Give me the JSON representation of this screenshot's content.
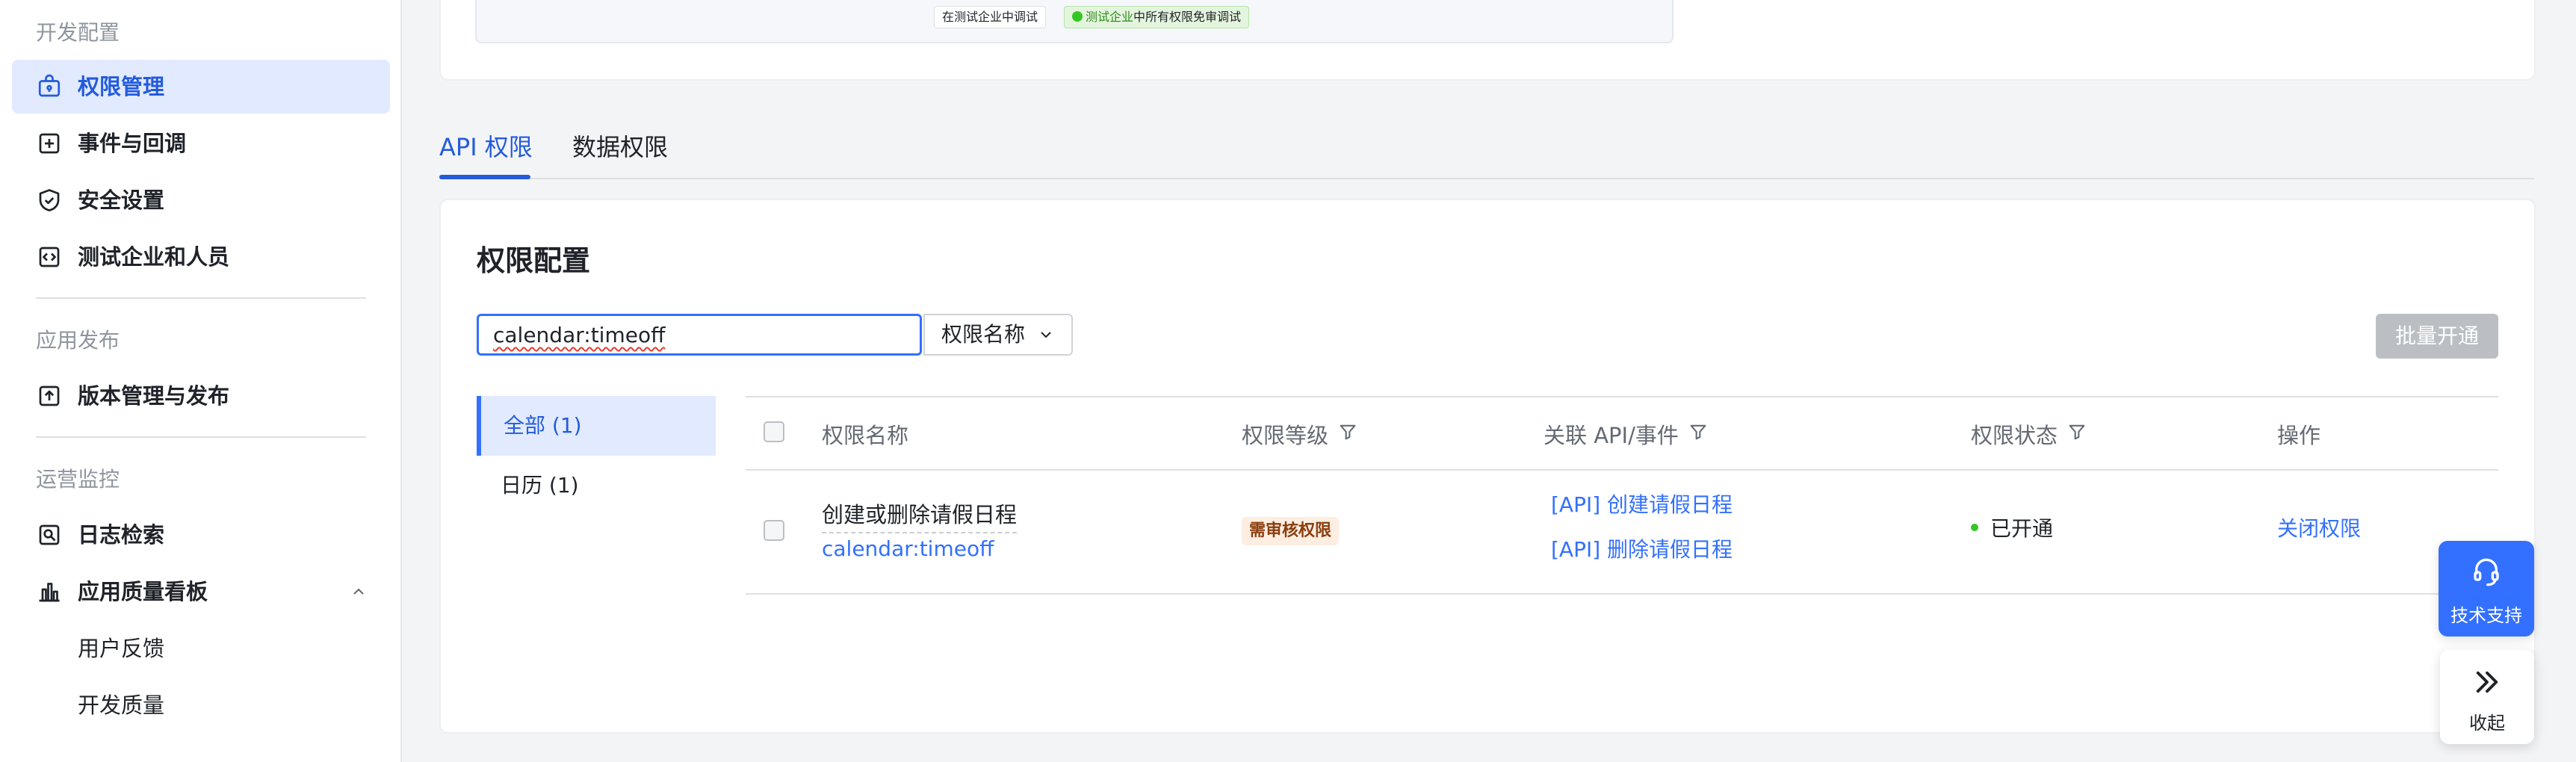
{
  "sidebar": {
    "sections": [
      {
        "title": "开发配置"
      },
      {
        "title": "应用发布"
      },
      {
        "title": "运营监控"
      }
    ],
    "items": {
      "permissions": "权限管理",
      "events": "事件与回调",
      "security": "安全设置",
      "test_tenant": "测试企业和人员",
      "versions": "版本管理与发布",
      "log_search": "日志检索",
      "quality_board": "应用质量看板",
      "user_feedback": "用户反馈",
      "dev_quality": "开发质量"
    }
  },
  "top_flow": {
    "chip1": "在测试企业中调试",
    "chip2_highlight": "测试企业",
    "chip2_rest": "中所有权限免审调试"
  },
  "tabs": [
    {
      "label": "API 权限",
      "active": true
    },
    {
      "label": "数据权限",
      "active": false
    }
  ],
  "card": {
    "title": "权限配置",
    "search_value": "calendar:timeoff",
    "field_select": "权限名称",
    "batch_button": "批量开通"
  },
  "categories": [
    {
      "label": "全部 (1)",
      "active": true
    },
    {
      "label": "日历 (1)",
      "active": false
    }
  ],
  "table": {
    "headers": {
      "name": "权限名称",
      "level": "权限等级",
      "api": "关联 API/事件",
      "status": "权限状态",
      "action": "操作"
    },
    "rows": [
      {
        "name": "创建或删除请假日程",
        "code": "calendar:timeoff",
        "level_badge": "需审核权限",
        "apis": [
          "[API] 创建请假日程",
          "[API] 删除请假日程"
        ],
        "status": "已开通",
        "action": "关闭权限"
      }
    ]
  },
  "floating": {
    "support": "技术支持",
    "collapse": "收起"
  },
  "colors": {
    "accent": "#3370ff",
    "accent_text": "#245bdb",
    "active_bg": "#e1eaff",
    "status_green": "#34c724",
    "badge_bg": "#fdeee1",
    "disabled_btn": "#bbbfc4"
  }
}
